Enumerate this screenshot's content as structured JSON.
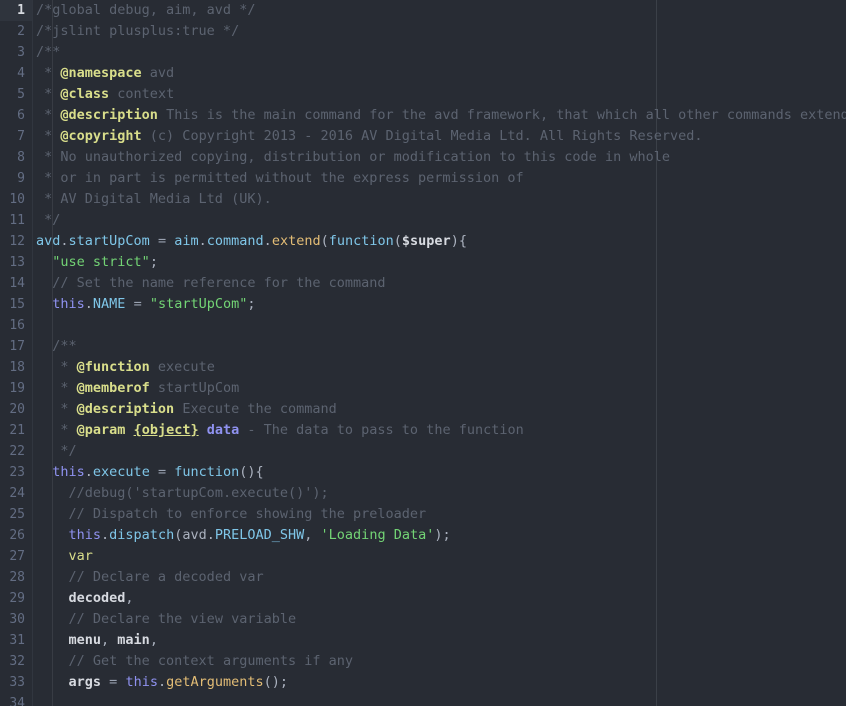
{
  "editor": {
    "name": "code-editor",
    "theme": "one-dark",
    "background": "#282c34",
    "gutter_background": "#282c34",
    "active_line_background": "#2f343d",
    "ruler_color": "#3b4048",
    "active_line_number": 1,
    "first_visible_line": 1,
    "last_visible_line": 34,
    "language": "JavaScript",
    "colors": {
      "comment": "#5c6370",
      "doc_tag": "#d9de8b",
      "doc_type": "#d9de8b",
      "doc_param": "#8f92f0",
      "property": "#7fc6e8",
      "function": "#e3bd76",
      "keyword": "#8f92f0",
      "keyword_storage": "#d9de8b",
      "string": "#73d475",
      "variable": "#d7dae0",
      "foreground": "#abb2bf",
      "line_number": "#636d83",
      "line_number_active": "#d7dae0"
    }
  },
  "gutter": {
    "line_numbers": [
      "1",
      "2",
      "3",
      "4",
      "5",
      "6",
      "7",
      "8",
      "9",
      "10",
      "11",
      "12",
      "13",
      "14",
      "15",
      "16",
      "17",
      "18",
      "19",
      "20",
      "21",
      "22",
      "23",
      "24",
      "25",
      "26",
      "27",
      "28",
      "29",
      "30",
      "31",
      "32",
      "33",
      "34"
    ]
  },
  "code": {
    "plain_text_lines": [
      "/*global debug, aim, avd */",
      "/*jslint plusplus:true */",
      "/**",
      " * @namespace avd",
      " * @class context",
      " * @description This is the main command for the avd framework, that which all other commands extend",
      " * @copyright (c) Copyright 2013 - 2016 AV Digital Media Ltd. All Rights Reserved.",
      " * No unauthorized copying, distribution or modification to this code in whole",
      " * or in part is permitted without the express permission of",
      " * AV Digital Media Ltd (UK).",
      " */",
      "avd.startUpCom = aim.command.extend(function($super){",
      "  \"use strict\";",
      "  // Set the name reference for the command",
      "  this.NAME = \"startUpCom\";",
      "",
      "  /**",
      "   * @function execute",
      "   * @memberof startUpCom",
      "   * @description Execute the command",
      "   * @param {object} data - The data to pass to the function",
      "   */",
      "  this.execute = function(){",
      "    //debug('startupCom.execute()');",
      "    // Dispatch to enforce showing the preloader",
      "    this.dispatch(avd.PRELOAD_SHW, 'Loading Data');",
      "    var",
      "    // Declare a decoded var",
      "    decoded,",
      "    // Declare the view variable",
      "    menu, main,",
      "    // Get the context arguments if any",
      "    args = this.getArguments();",
      ""
    ],
    "lines": [
      {
        "n": 1,
        "tokens": [
          {
            "t": "/*global debug, aim, avd */",
            "c": "t-comment"
          }
        ]
      },
      {
        "n": 2,
        "tokens": [
          {
            "t": "/*jslint plusplus:true */",
            "c": "t-comment"
          }
        ]
      },
      {
        "n": 3,
        "tokens": [
          {
            "t": "/**",
            "c": "t-doc"
          }
        ]
      },
      {
        "n": 4,
        "tokens": [
          {
            "t": " * ",
            "c": "t-doc"
          },
          {
            "t": "@namespace",
            "c": "t-tag"
          },
          {
            "t": " avd",
            "c": "t-doc"
          }
        ]
      },
      {
        "n": 5,
        "tokens": [
          {
            "t": " * ",
            "c": "t-doc"
          },
          {
            "t": "@class",
            "c": "t-tag"
          },
          {
            "t": " context",
            "c": "t-doc"
          }
        ]
      },
      {
        "n": 6,
        "tokens": [
          {
            "t": " * ",
            "c": "t-doc"
          },
          {
            "t": "@description",
            "c": "t-tag"
          },
          {
            "t": " This is the main command for the avd framework, that which all other commands extend",
            "c": "t-doc"
          }
        ]
      },
      {
        "n": 7,
        "tokens": [
          {
            "t": " * ",
            "c": "t-doc"
          },
          {
            "t": "@copyright",
            "c": "t-tag"
          },
          {
            "t": " (c) Copyright 2013 - 2016 AV Digital Media Ltd. All Rights Reserved.",
            "c": "t-doc"
          }
        ]
      },
      {
        "n": 8,
        "tokens": [
          {
            "t": " * No unauthorized copying, distribution or modification to this code in whole",
            "c": "t-doc"
          }
        ]
      },
      {
        "n": 9,
        "tokens": [
          {
            "t": " * or in part is permitted without the express permission of",
            "c": "t-doc"
          }
        ]
      },
      {
        "n": 10,
        "tokens": [
          {
            "t": " * AV Digital Media Ltd (UK).",
            "c": "t-doc"
          }
        ]
      },
      {
        "n": 11,
        "tokens": [
          {
            "t": " */",
            "c": "t-doc"
          }
        ]
      },
      {
        "n": 12,
        "tokens": [
          {
            "t": "avd",
            "c": "t-prop"
          },
          {
            "t": ".",
            "c": "t-punc"
          },
          {
            "t": "startUpCom",
            "c": "t-prop"
          },
          {
            "t": " ",
            "c": "t-plain"
          },
          {
            "t": "=",
            "c": "t-op"
          },
          {
            "t": " ",
            "c": "t-plain"
          },
          {
            "t": "aim",
            "c": "t-prop"
          },
          {
            "t": ".",
            "c": "t-punc"
          },
          {
            "t": "command",
            "c": "t-prop"
          },
          {
            "t": ".",
            "c": "t-punc"
          },
          {
            "t": "extend",
            "c": "t-func"
          },
          {
            "t": "(",
            "c": "t-punc"
          },
          {
            "t": "function",
            "c": "t-prop"
          },
          {
            "t": "(",
            "c": "t-punc"
          },
          {
            "t": "$super",
            "c": "t-var"
          },
          {
            "t": ")",
            "c": "t-punc"
          },
          {
            "t": "{",
            "c": "t-punc"
          }
        ]
      },
      {
        "n": 13,
        "tokens": [
          {
            "t": "  ",
            "c": "t-plain"
          },
          {
            "t": "\"use strict\"",
            "c": "t-string"
          },
          {
            "t": ";",
            "c": "t-punc"
          }
        ]
      },
      {
        "n": 14,
        "tokens": [
          {
            "t": "  ",
            "c": "t-plain"
          },
          {
            "t": "// Set the name reference for the command",
            "c": "t-comment"
          }
        ]
      },
      {
        "n": 15,
        "tokens": [
          {
            "t": "  ",
            "c": "t-plain"
          },
          {
            "t": "this",
            "c": "t-keyword"
          },
          {
            "t": ".",
            "c": "t-punc"
          },
          {
            "t": "NAME",
            "c": "t-prop"
          },
          {
            "t": " ",
            "c": "t-plain"
          },
          {
            "t": "=",
            "c": "t-op"
          },
          {
            "t": " ",
            "c": "t-plain"
          },
          {
            "t": "\"startUpCom\"",
            "c": "t-string"
          },
          {
            "t": ";",
            "c": "t-punc"
          }
        ]
      },
      {
        "n": 16,
        "tokens": [
          {
            "t": "",
            "c": "t-plain"
          }
        ]
      },
      {
        "n": 17,
        "tokens": [
          {
            "t": "  /**",
            "c": "t-doc"
          }
        ]
      },
      {
        "n": 18,
        "tokens": [
          {
            "t": "   * ",
            "c": "t-doc"
          },
          {
            "t": "@function",
            "c": "t-tag"
          },
          {
            "t": " execute",
            "c": "t-doc"
          }
        ]
      },
      {
        "n": 19,
        "tokens": [
          {
            "t": "   * ",
            "c": "t-doc"
          },
          {
            "t": "@memberof",
            "c": "t-tag"
          },
          {
            "t": " startUpCom",
            "c": "t-doc"
          }
        ]
      },
      {
        "n": 20,
        "tokens": [
          {
            "t": "   * ",
            "c": "t-doc"
          },
          {
            "t": "@description",
            "c": "t-tag"
          },
          {
            "t": " Execute the command",
            "c": "t-doc"
          }
        ]
      },
      {
        "n": 21,
        "tokens": [
          {
            "t": "   * ",
            "c": "t-doc"
          },
          {
            "t": "@param",
            "c": "t-tag"
          },
          {
            "t": " ",
            "c": "t-doc"
          },
          {
            "t": "{object}",
            "c": "t-type"
          },
          {
            "t": " ",
            "c": "t-doc"
          },
          {
            "t": "data",
            "c": "t-param"
          },
          {
            "t": " - The data to pass to the function",
            "c": "t-doc"
          }
        ]
      },
      {
        "n": 22,
        "tokens": [
          {
            "t": "   */",
            "c": "t-doc"
          }
        ]
      },
      {
        "n": 23,
        "tokens": [
          {
            "t": "  ",
            "c": "t-plain"
          },
          {
            "t": "this",
            "c": "t-keyword"
          },
          {
            "t": ".",
            "c": "t-punc"
          },
          {
            "t": "execute",
            "c": "t-prop"
          },
          {
            "t": " ",
            "c": "t-plain"
          },
          {
            "t": "=",
            "c": "t-op"
          },
          {
            "t": " ",
            "c": "t-plain"
          },
          {
            "t": "function",
            "c": "t-prop"
          },
          {
            "t": "(){",
            "c": "t-punc"
          }
        ]
      },
      {
        "n": 24,
        "tokens": [
          {
            "t": "    ",
            "c": "t-plain"
          },
          {
            "t": "//debug('startupCom.execute()');",
            "c": "t-comment"
          }
        ]
      },
      {
        "n": 25,
        "tokens": [
          {
            "t": "    ",
            "c": "t-plain"
          },
          {
            "t": "// Dispatch to enforce showing the preloader",
            "c": "t-comment"
          }
        ]
      },
      {
        "n": 26,
        "tokens": [
          {
            "t": "    ",
            "c": "t-plain"
          },
          {
            "t": "this",
            "c": "t-keyword"
          },
          {
            "t": ".",
            "c": "t-punc"
          },
          {
            "t": "dispatch",
            "c": "t-prop"
          },
          {
            "t": "(",
            "c": "t-punc"
          },
          {
            "t": "avd",
            "c": "t-plain"
          },
          {
            "t": ".",
            "c": "t-punc"
          },
          {
            "t": "PRELOAD_SHW",
            "c": "t-prop"
          },
          {
            "t": ", ",
            "c": "t-punc"
          },
          {
            "t": "'Loading Data'",
            "c": "t-string"
          },
          {
            "t": ");",
            "c": "t-punc"
          }
        ]
      },
      {
        "n": 27,
        "tokens": [
          {
            "t": "    ",
            "c": "t-plain"
          },
          {
            "t": "var",
            "c": "t-kw2"
          }
        ]
      },
      {
        "n": 28,
        "tokens": [
          {
            "t": "    ",
            "c": "t-plain"
          },
          {
            "t": "// Declare a decoded var",
            "c": "t-comment"
          }
        ]
      },
      {
        "n": 29,
        "tokens": [
          {
            "t": "    ",
            "c": "t-plain"
          },
          {
            "t": "decoded",
            "c": "t-var"
          },
          {
            "t": ",",
            "c": "t-punc"
          }
        ]
      },
      {
        "n": 30,
        "tokens": [
          {
            "t": "    ",
            "c": "t-plain"
          },
          {
            "t": "// Declare the view variable",
            "c": "t-comment"
          }
        ]
      },
      {
        "n": 31,
        "tokens": [
          {
            "t": "    ",
            "c": "t-plain"
          },
          {
            "t": "menu",
            "c": "t-var"
          },
          {
            "t": ", ",
            "c": "t-punc"
          },
          {
            "t": "main",
            "c": "t-var"
          },
          {
            "t": ",",
            "c": "t-punc"
          }
        ]
      },
      {
        "n": 32,
        "tokens": [
          {
            "t": "    ",
            "c": "t-plain"
          },
          {
            "t": "// Get the context arguments if any",
            "c": "t-comment"
          }
        ]
      },
      {
        "n": 33,
        "tokens": [
          {
            "t": "    ",
            "c": "t-plain"
          },
          {
            "t": "args",
            "c": "t-var"
          },
          {
            "t": " ",
            "c": "t-plain"
          },
          {
            "t": "=",
            "c": "t-op"
          },
          {
            "t": " ",
            "c": "t-plain"
          },
          {
            "t": "this",
            "c": "t-keyword"
          },
          {
            "t": ".",
            "c": "t-punc"
          },
          {
            "t": "getArguments",
            "c": "t-func"
          },
          {
            "t": "();",
            "c": "t-punc"
          }
        ]
      },
      {
        "n": 34,
        "tokens": [
          {
            "t": "",
            "c": "t-plain"
          }
        ]
      }
    ]
  }
}
